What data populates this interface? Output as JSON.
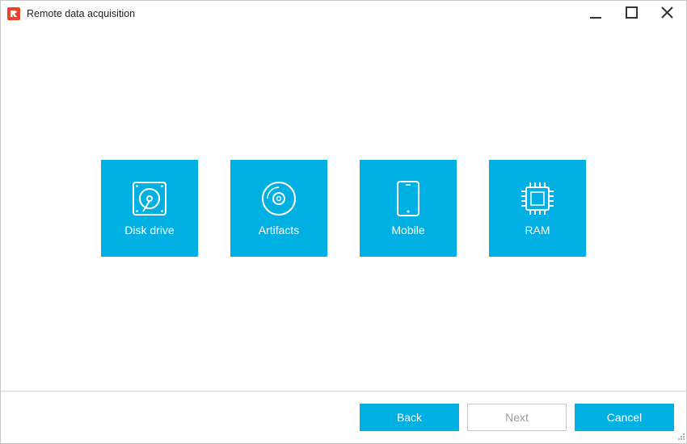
{
  "window": {
    "title": "Remote data acquisition",
    "accent_color": "#00b0e3",
    "app_icon": "app-logo-icon"
  },
  "titlebar_controls": {
    "minimize_icon": "minimize-icon",
    "maximize_icon": "maximize-icon",
    "close_icon": "close-icon"
  },
  "tiles": [
    {
      "label": "Disk drive",
      "icon": "hard-disk-icon"
    },
    {
      "label": "Artifacts",
      "icon": "disc-icon"
    },
    {
      "label": "Mobile",
      "icon": "smartphone-icon"
    },
    {
      "label": "RAM",
      "icon": "memory-chip-icon"
    }
  ],
  "footer": {
    "back_label": "Back",
    "next_label": "Next",
    "cancel_label": "Cancel",
    "next_enabled": false
  }
}
